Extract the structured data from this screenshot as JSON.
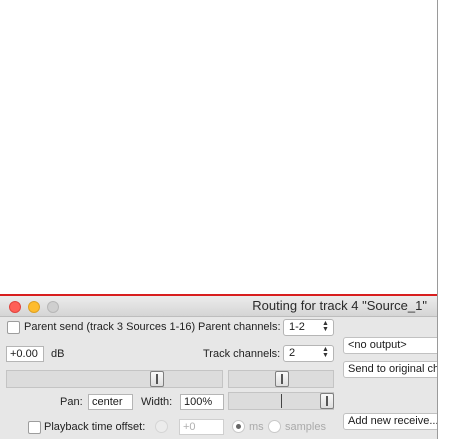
{
  "window": {
    "title": "Routing for track 4 \"Source_1\""
  },
  "parent_send": {
    "checkbox_label": "Parent send (track 3 Sources 1-16)",
    "channels_label": "Parent channels:",
    "channels_value": "1-2"
  },
  "volume": {
    "value": "+0.00",
    "unit": "dB"
  },
  "track_channels": {
    "label": "Track channels:",
    "value": "2"
  },
  "output": {
    "selected": "<no output>",
    "send_original_label": "Send to original cha",
    "add_receive_label": "Add new receive..."
  },
  "pan": {
    "label": "Pan:",
    "value": "center",
    "width_label": "Width:",
    "width_value": "100%"
  },
  "playback_offset": {
    "label": "Playback time offset:",
    "value": "+0",
    "unit_ms": "ms",
    "unit_samples": "samples"
  },
  "icons": {
    "close": "close-icon",
    "minimize": "minimize-icon",
    "zoom": "zoom-icon",
    "stepper": "stepper-icon"
  },
  "colors": {
    "accent_line": "#d81e1e",
    "close": "#ff5f57",
    "minimize": "#febc2e"
  }
}
